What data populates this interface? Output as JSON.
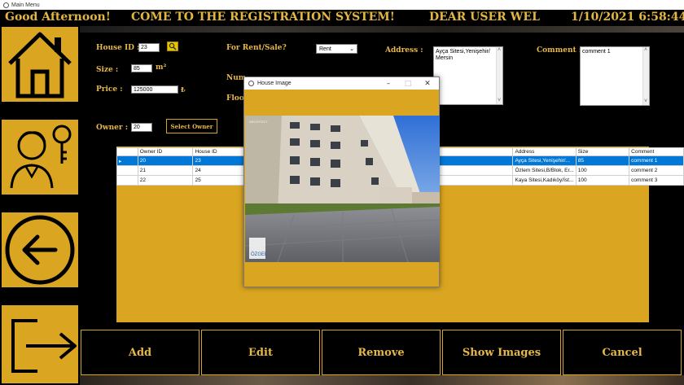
{
  "window": {
    "title": "Main Menu"
  },
  "header": {
    "greeting": "Good Afternoon!",
    "welcome": "COME TO THE REGISTRATION SYSTEM!",
    "user": "DEAR USER WEL",
    "datetime": "1/10/2021 6:58:44 PM"
  },
  "sidebar": {
    "items": [
      {
        "name": "home-icon"
      },
      {
        "name": "owner-icon"
      },
      {
        "name": "back-arrow-icon"
      },
      {
        "name": "exit-icon"
      }
    ]
  },
  "form": {
    "house_id_label": "House ID :",
    "house_id_value": "23",
    "size_label": "Size :",
    "size_value": "85",
    "size_unit": "m²",
    "price_label": "Price :",
    "price_value": "125000",
    "price_unit": "₺",
    "rent_sale_label": "For Rent/Sale?",
    "rent_sale_value": "Rent",
    "number_label": "Num",
    "floor_label": "Floo",
    "address_label": "Address :",
    "address_value": "Ayça Sitesi,Yenişehir/Mersin",
    "comment_label": "Comment :",
    "comment_value": "comment 1",
    "owner_label": "Owner :",
    "owner_value": "20",
    "select_owner_label": "Select Owner"
  },
  "grid": {
    "columns": [
      "Owner ID",
      "House ID",
      "Address",
      "Size",
      "Comment"
    ],
    "rows": [
      [
        "20",
        "23",
        "Ayça Sitesi,Yenişehir/...",
        "85",
        "comment 1"
      ],
      [
        "21",
        "24",
        "Özlem Sitesi,B/Blok, Er...",
        "100",
        "comment 2"
      ],
      [
        "22",
        "25",
        "Kaya Sitesi,Kadıköy/İst...",
        "100",
        "comment 3"
      ]
    ],
    "selected_row_marker": "▸"
  },
  "popup": {
    "title": "House Image",
    "watermark": "ÖZGEL",
    "watermark_small": "ARCHITECT"
  },
  "actions": {
    "add": "Add",
    "edit": "Edit",
    "remove": "Remove",
    "show_images": "Show Images",
    "cancel": "Cancel"
  },
  "colors": {
    "accent": "#daa520",
    "text_gold": "#e6b847",
    "selection": "#0078d7"
  }
}
